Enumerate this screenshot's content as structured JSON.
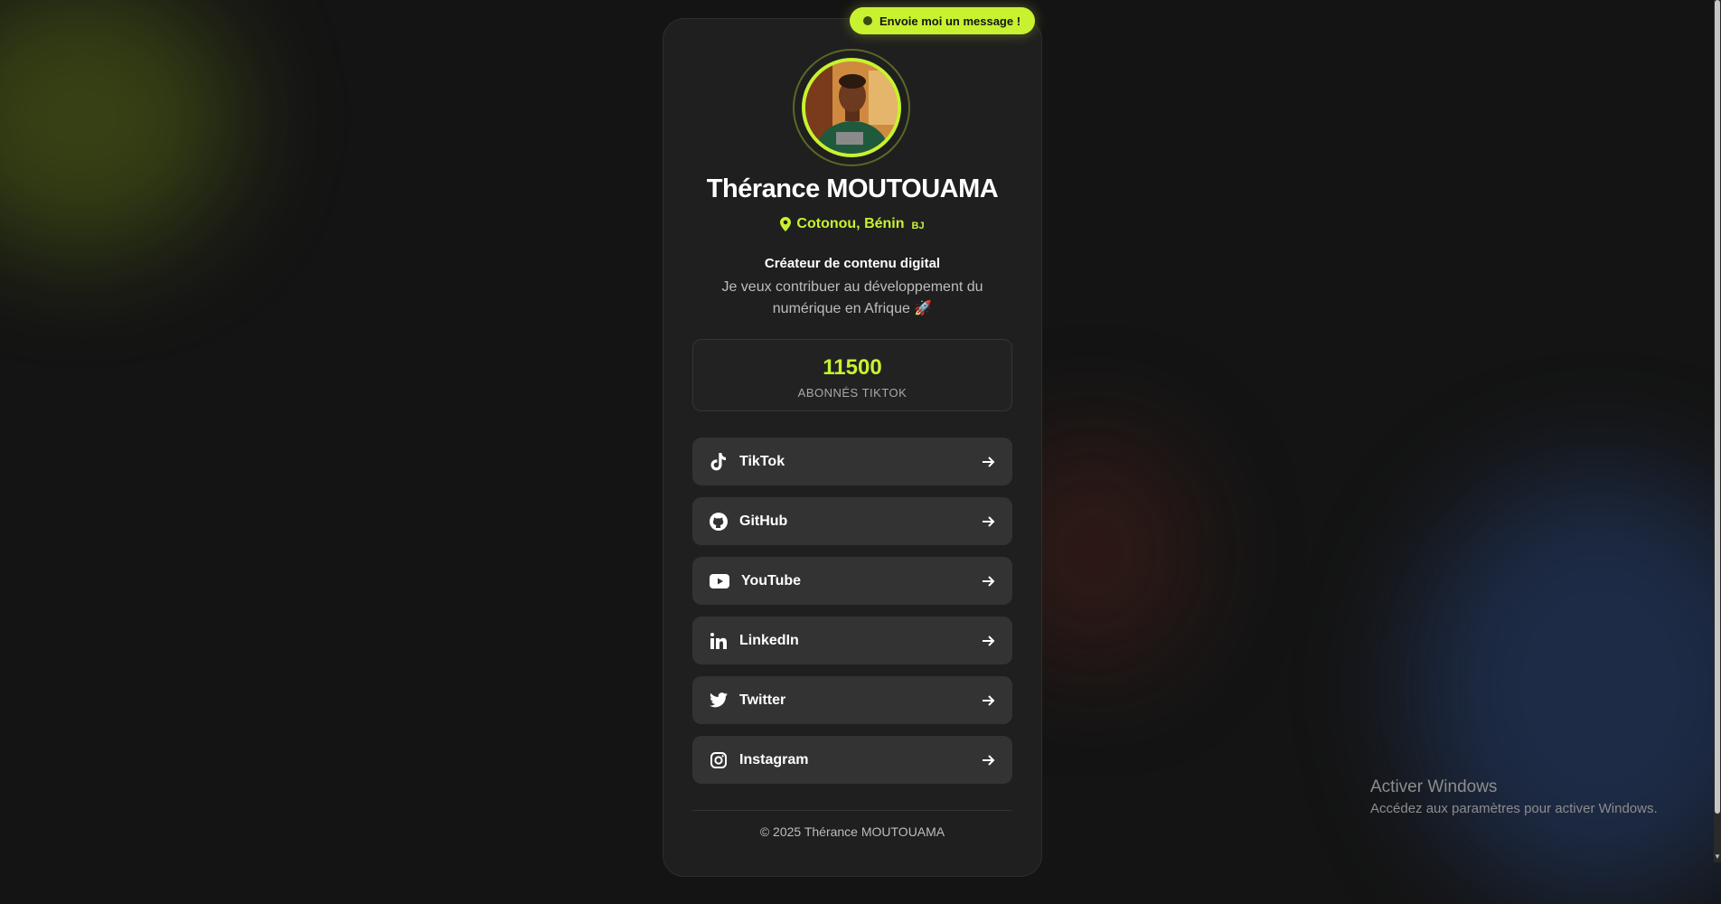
{
  "message_button": {
    "label": "Envoie moi un message !"
  },
  "profile": {
    "name": "Thérance MOUTOUAMA",
    "location": "Cotonou, Bénin",
    "country_code": "BJ",
    "role": "Créateur de contenu digital",
    "bio": "Je veux contribuer au développement du numérique en Afrique 🚀"
  },
  "stats": {
    "value": "11500",
    "label": "ABONNÉS TIKTOK"
  },
  "links": [
    {
      "label": "TikTok",
      "icon": "tiktok-icon"
    },
    {
      "label": "GitHub",
      "icon": "github-icon"
    },
    {
      "label": "YouTube",
      "icon": "youtube-icon"
    },
    {
      "label": "LinkedIn",
      "icon": "linkedin-icon"
    },
    {
      "label": "Twitter",
      "icon": "twitter-icon"
    },
    {
      "label": "Instagram",
      "icon": "instagram-icon"
    }
  ],
  "footer": {
    "copyright": "© 2025 Thérance MOUTOUAMA"
  },
  "windows_watermark": {
    "title": "Activer Windows",
    "subtitle": "Accédez aux paramètres pour activer Windows."
  },
  "colors": {
    "accent": "#c8f230",
    "card": "#1f1f1f",
    "link_bg": "#333333",
    "page_bg": "#141414"
  }
}
